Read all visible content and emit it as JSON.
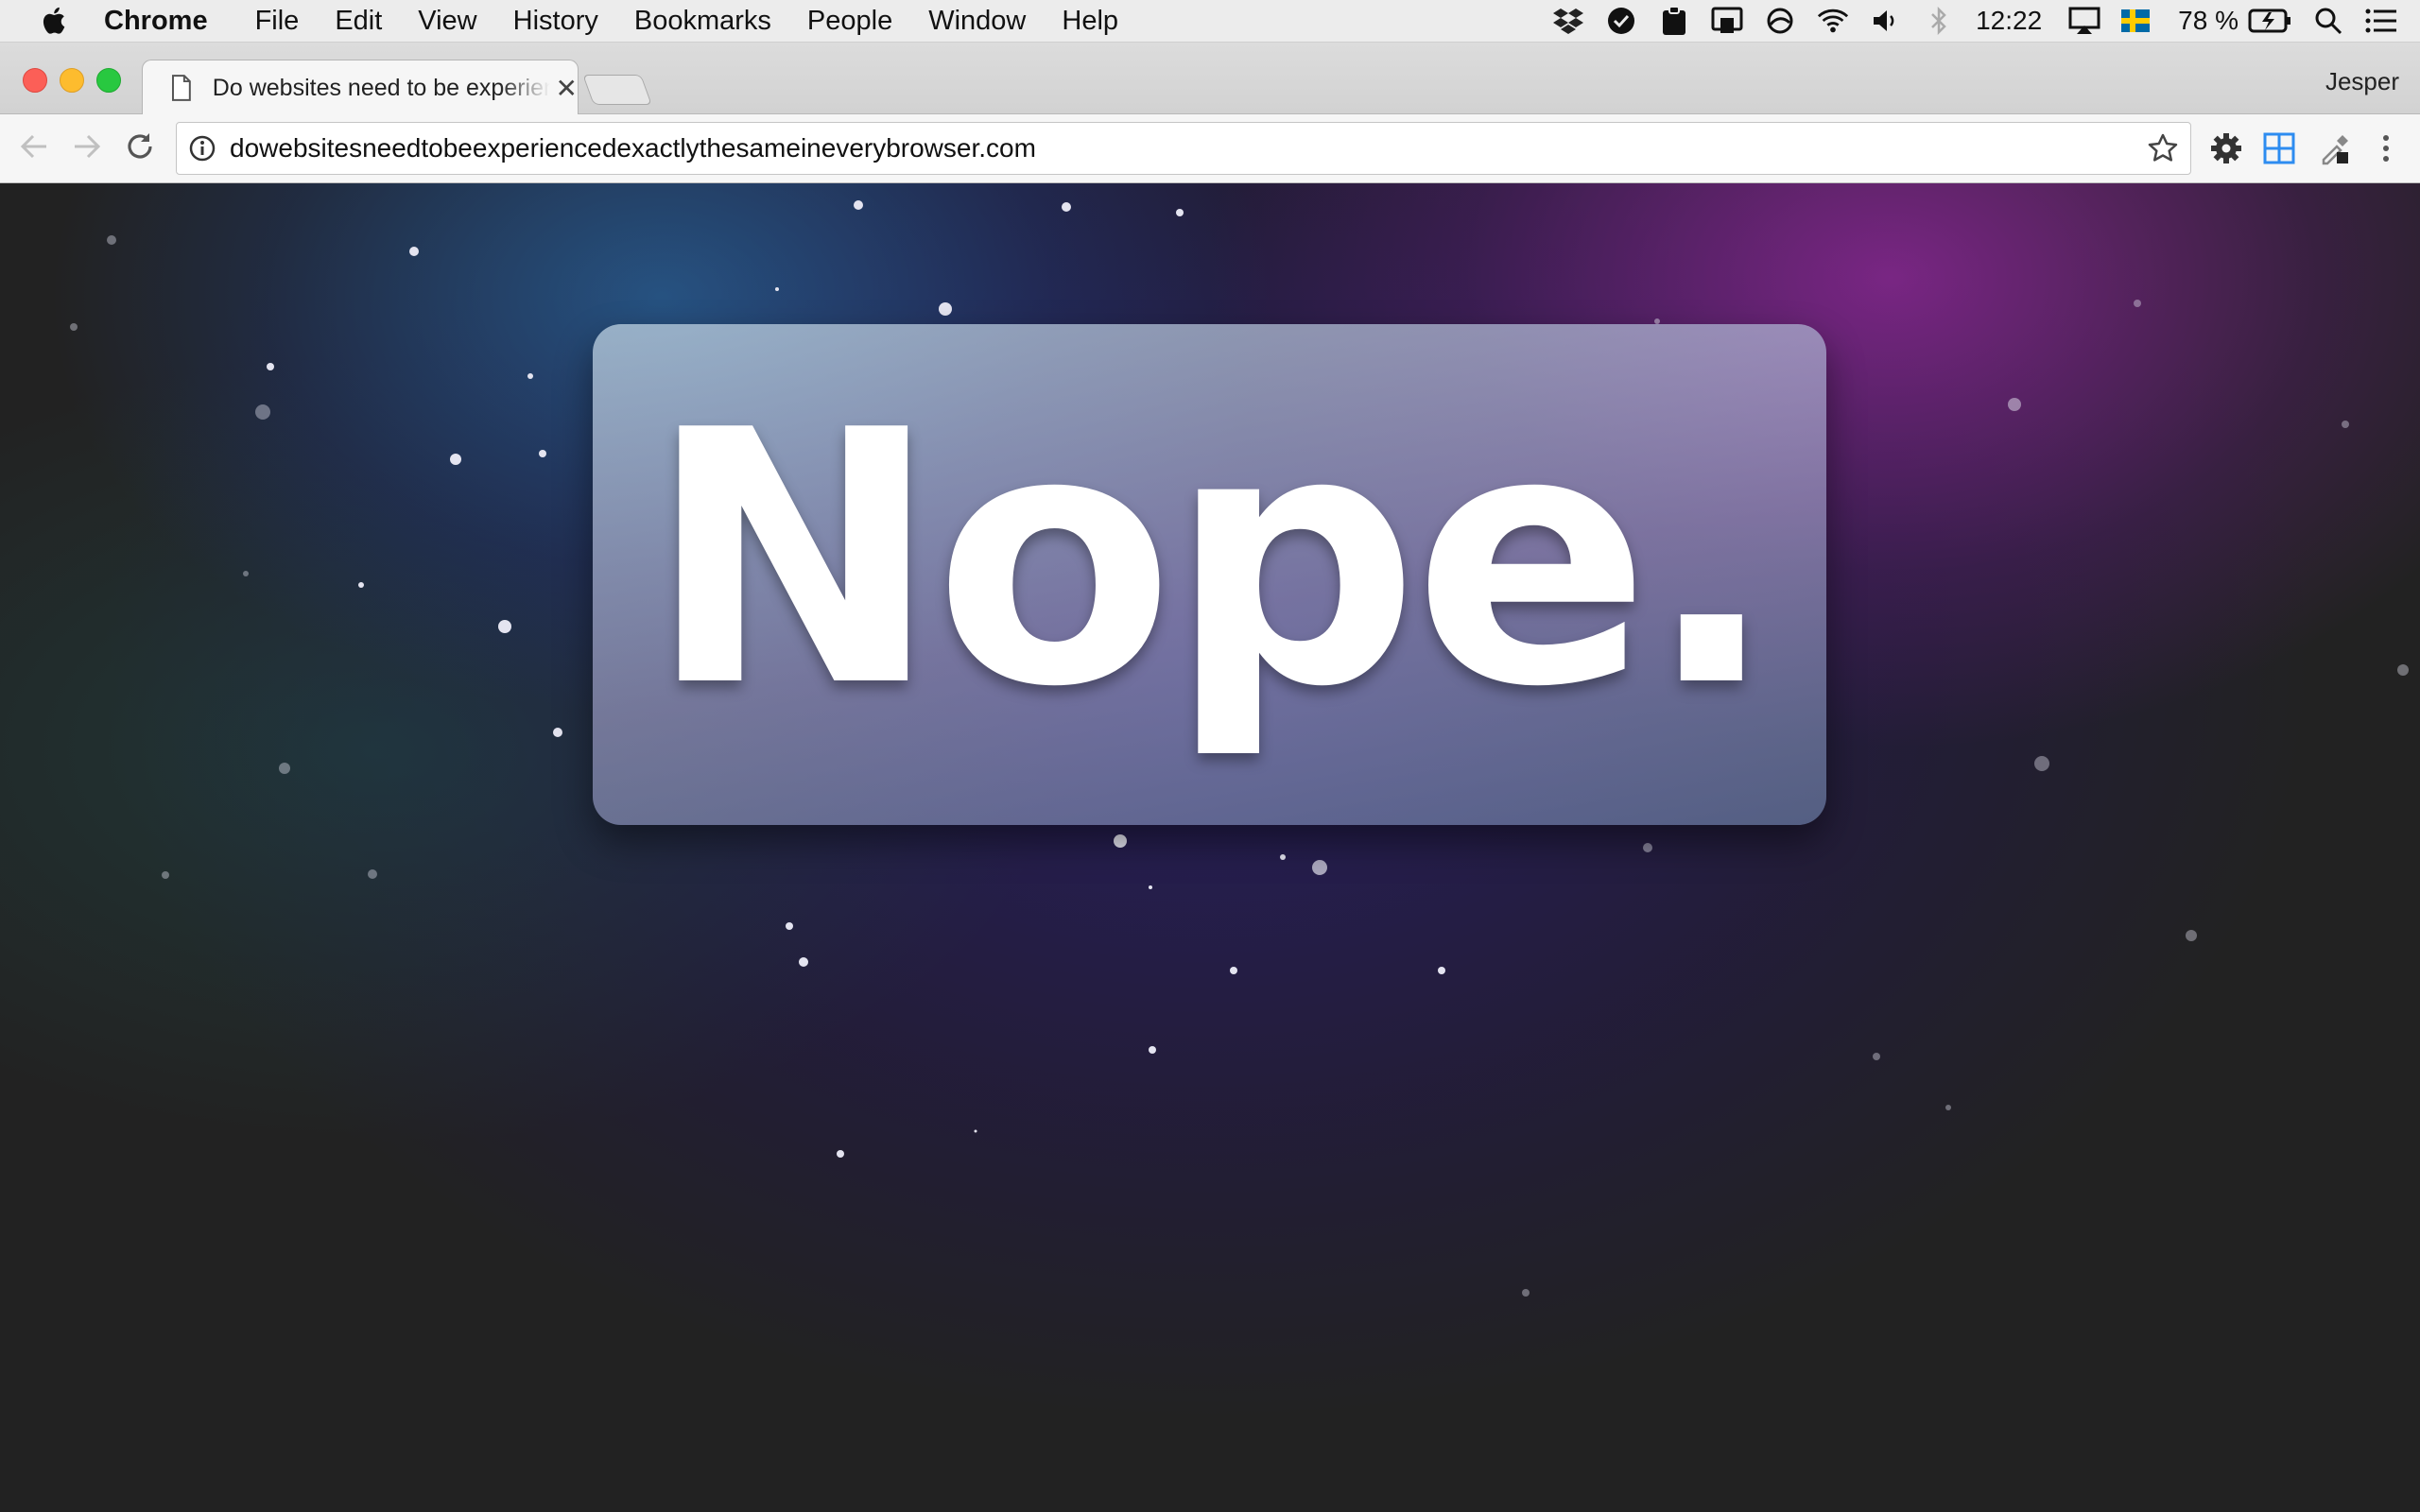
{
  "menubar": {
    "app_name": "Chrome",
    "items": [
      "File",
      "Edit",
      "View",
      "History",
      "Bookmarks",
      "People",
      "Window",
      "Help"
    ],
    "clock": "12:22",
    "battery": "78 %"
  },
  "browser": {
    "tab_title": "Do websites need to be experienced exactly the same in every browser?",
    "profile_name": "Jesper",
    "url": "dowebsitesneedtobeexperiencedexactlythesameineverybrowser.com"
  },
  "page": {
    "headline": "Nope."
  },
  "colors": {
    "menubar_bg": "#ececec",
    "page_bg": "#222222",
    "purple_glow": "#8e2a9c",
    "blue_glow": "#2a6aa8"
  }
}
